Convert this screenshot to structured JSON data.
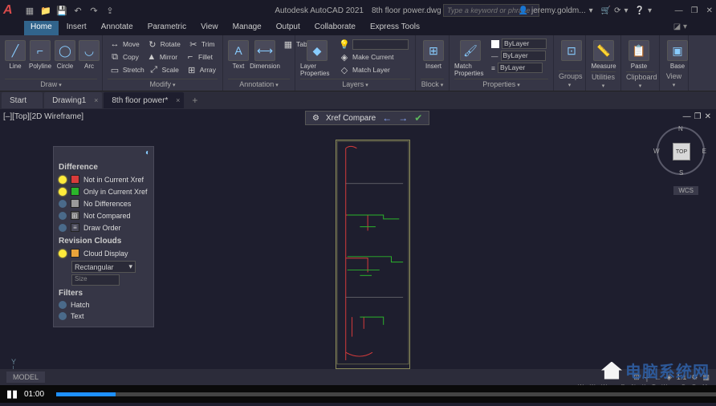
{
  "app": {
    "name": "Autodesk AutoCAD 2021",
    "file": "8th floor power.dwg"
  },
  "search": {
    "placeholder": "Type a keyword or phrase"
  },
  "user": {
    "name": "jeremy.goldm..."
  },
  "menu_tabs": [
    "Home",
    "Insert",
    "Annotate",
    "Parametric",
    "View",
    "Manage",
    "Output",
    "Collaborate",
    "Express Tools"
  ],
  "active_menu": "Home",
  "ribbon": {
    "draw": {
      "title": "Draw",
      "tools": [
        "Line",
        "Polyline",
        "Circle",
        "Arc"
      ]
    },
    "modify": {
      "title": "Modify",
      "rows": [
        [
          "↔",
          "Move",
          "↻",
          "Rotate",
          "✂",
          "Trim"
        ],
        [
          "⧉",
          "Copy",
          "▲",
          "Mirror",
          "⌐",
          "Fillet"
        ],
        [
          "▭",
          "Stretch",
          "⤢",
          "Scale",
          "⊞",
          "Array"
        ]
      ]
    },
    "annotation": {
      "title": "Annotation",
      "big": [
        "Text",
        "Dimension"
      ],
      "row": "Table"
    },
    "layers": {
      "title": "Layers",
      "big": "Layer Properties",
      "items": [
        "Make Current",
        "Match Layer"
      ]
    },
    "block": {
      "title": "Block",
      "big": "Insert"
    },
    "properties": {
      "title": "Properties",
      "big": "Match Properties",
      "vals": [
        "ByLayer",
        "ByLayer",
        "ByLayer"
      ]
    },
    "groups": {
      "title": "Groups"
    },
    "utilities": {
      "title": "Utilities",
      "big": "Measure"
    },
    "clipboard": {
      "title": "Clipboard",
      "big": "Paste"
    },
    "view": {
      "title": "View",
      "big": "Base"
    }
  },
  "doc_tabs": [
    {
      "label": "Start",
      "active": false,
      "close": false
    },
    {
      "label": "Drawing1",
      "active": false,
      "close": true
    },
    {
      "label": "8th floor power*",
      "active": true,
      "close": true
    }
  ],
  "viewport": {
    "label": "[–][Top][2D Wireframe]"
  },
  "xref_bar": {
    "label": "Xref Compare"
  },
  "viewcube": {
    "face": "TOP",
    "n": "N",
    "s": "S",
    "e": "E",
    "w": "W",
    "wcs": "WCS"
  },
  "compare_panel": {
    "sections": {
      "difference": "Difference",
      "revision": "Revision Clouds",
      "filters": "Filters"
    },
    "diff_rows": [
      {
        "bulb": "on",
        "color": "#d83b3b",
        "label": "Not in Current Xref"
      },
      {
        "bulb": "on",
        "color": "#2bb52b",
        "label": "Only in Current Xref"
      },
      {
        "bulb": "off",
        "color": "#9a9a9a",
        "label": "No Differences"
      },
      {
        "bulb": "off",
        "color": "#6a6a6a",
        "label": "Not Compared",
        "icon": "⊞"
      },
      {
        "bulb": "off",
        "color": "",
        "label": "Draw Order",
        "icon": "≡"
      }
    ],
    "cloud_row": {
      "bulb": "on",
      "color": "#e8a33b",
      "label": "Cloud Display"
    },
    "shape": "Rectangular",
    "size_label": "Size",
    "filter_rows": [
      {
        "bulb": "off",
        "label": "Hatch"
      },
      {
        "bulb": "off",
        "label": "Text"
      }
    ]
  },
  "statusbar": {
    "model": "MODEL",
    "scale": "1:1"
  },
  "player": {
    "time": "01:00",
    "progress_pct": 9
  },
  "watermark": {
    "text": "电脑系统网",
    "sub": "W W W . D N X T W . C O M"
  },
  "ucs": {
    "y": "Y"
  }
}
